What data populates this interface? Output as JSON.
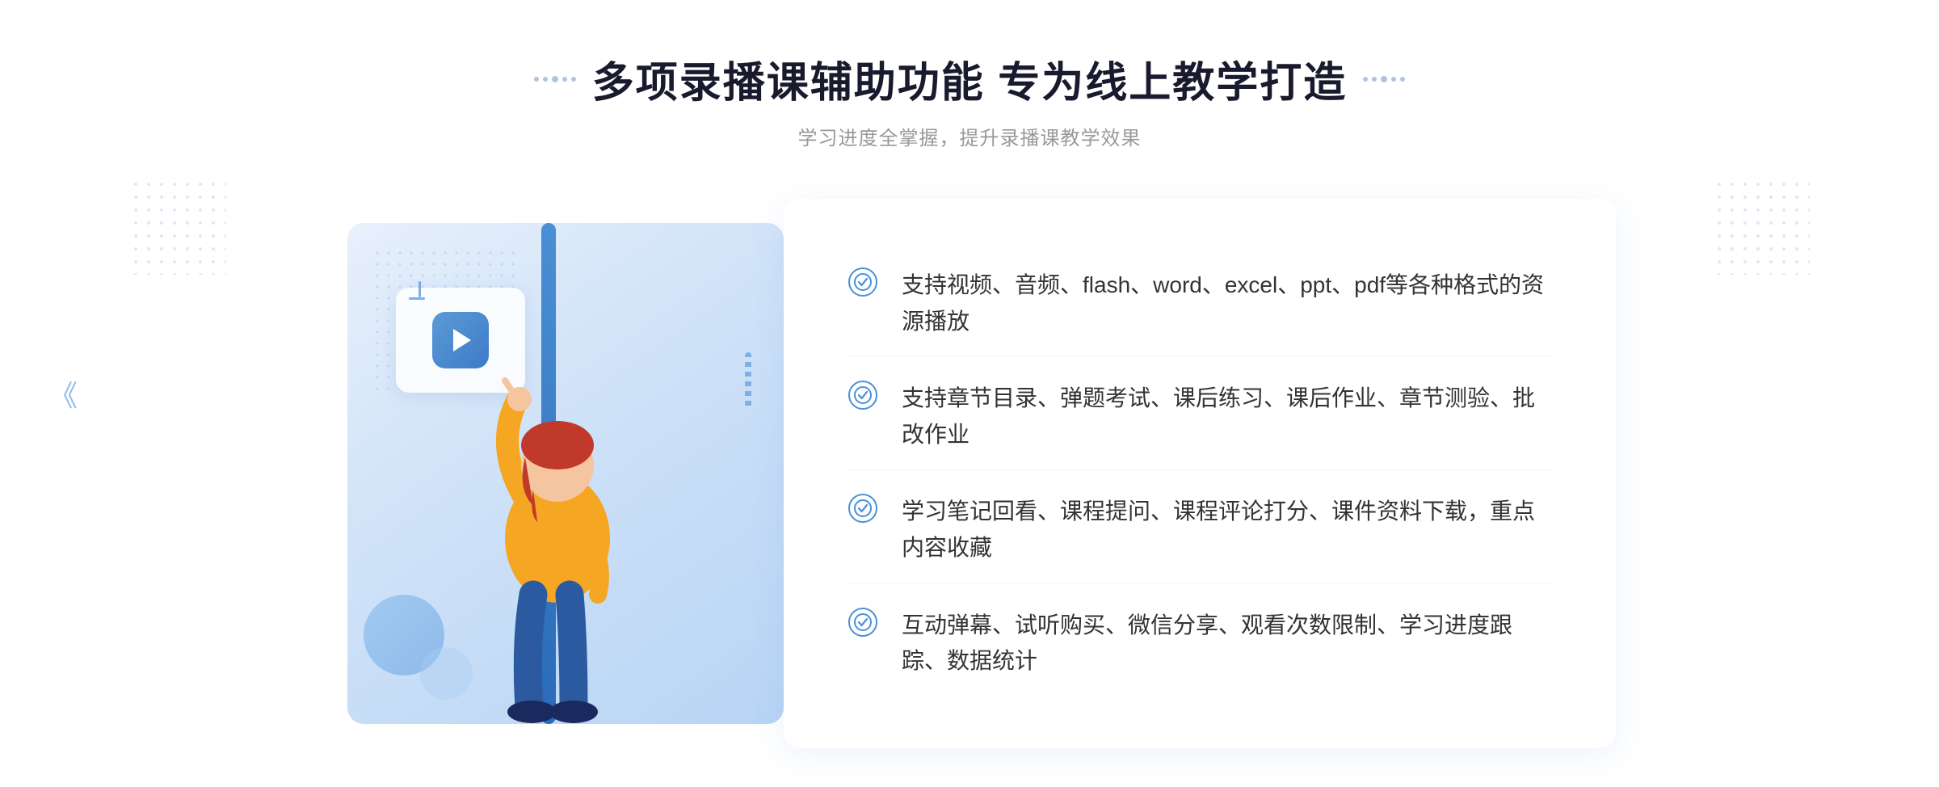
{
  "page": {
    "title": "多项录播课辅助功能 专为线上教学打造",
    "subtitle": "学习进度全掌握，提升录播课教学效果"
  },
  "features": [
    {
      "id": 1,
      "text": "支持视频、音频、flash、word、excel、ppt、pdf等各种格式的资源播放"
    },
    {
      "id": 2,
      "text": "支持章节目录、弹题考试、课后练习、课后作业、章节测验、批改作业"
    },
    {
      "id": 3,
      "text": "学习笔记回看、课程提问、课程评论打分、课件资料下载，重点内容收藏"
    },
    {
      "id": 4,
      "text": "互动弹幕、试听购买、微信分享、观看次数限制、学习进度跟踪、数据统计"
    }
  ],
  "icons": {
    "check": "✓",
    "play": "▶",
    "arrow_left": "《",
    "arrow_right": "》"
  },
  "colors": {
    "primary": "#4a90d9",
    "title": "#1a1a2e",
    "subtitle": "#999999",
    "text": "#333333",
    "bg_light": "#e8f2fd"
  }
}
